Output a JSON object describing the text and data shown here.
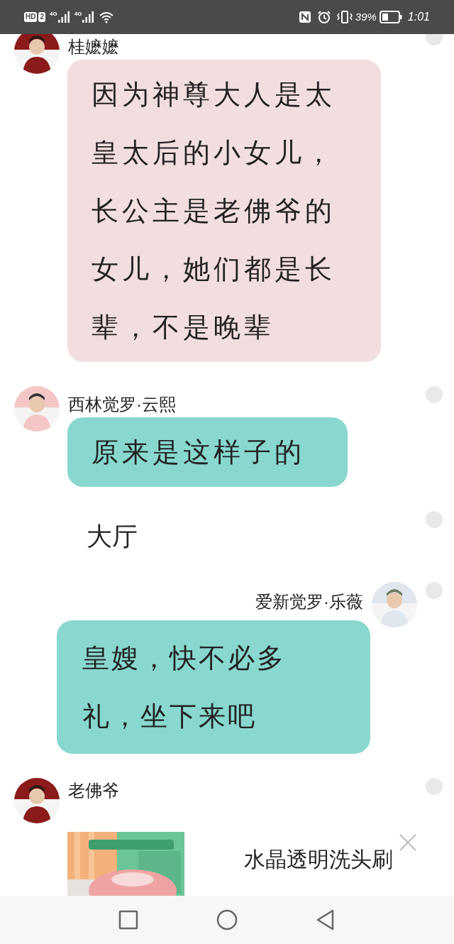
{
  "status_bar": {
    "network": "HD",
    "sim": "2",
    "signal_1": "4G",
    "signal_2": "4G",
    "battery": "39%",
    "time": "1:01"
  },
  "messages": [
    {
      "kind": "left",
      "sender": "桂嬷嬷",
      "text": "因为神尊大人是太皇太后的小女儿，长公主是老佛爷的女儿，她们都是长辈，不是晚辈",
      "color": "#f2dede"
    },
    {
      "kind": "left",
      "sender": "西林觉罗·云熙",
      "text": "原来是这样子的",
      "color": "#88d8cf"
    },
    {
      "kind": "system",
      "text": "大厅"
    },
    {
      "kind": "right",
      "sender": "爱新觉罗·乐薇",
      "text": "皇嫂，快不必多礼，坐下来吧",
      "color": "#88d8cf"
    },
    {
      "kind": "left",
      "sender": "老佛爷"
    }
  ],
  "ad": {
    "kind": "picture",
    "title": "水晶透明洗头刷"
  }
}
